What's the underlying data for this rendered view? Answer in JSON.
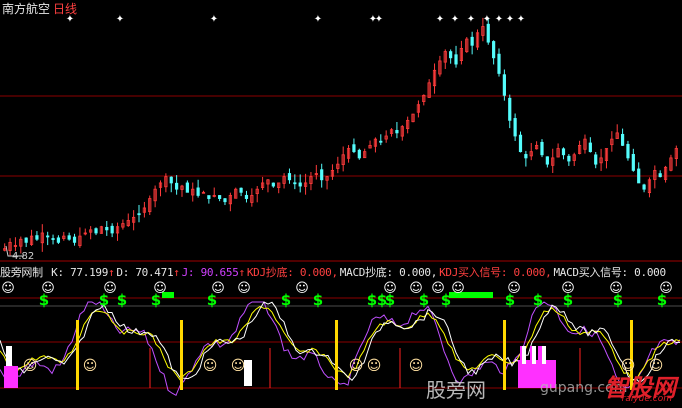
{
  "header": {
    "stock_name": "南方航空",
    "period": "日线"
  },
  "price_label": "4.82",
  "indicator": {
    "name": "股旁网制",
    "items": [
      {
        "text": "K: 77.199",
        "color": "#e6e6e6",
        "arrow": "↑"
      },
      {
        "text": "D: 70.471",
        "color": "#e6e6e6",
        "arrow": "↑"
      },
      {
        "text": "J: 90.655",
        "color": "#d040ff",
        "arrow": "↑"
      },
      {
        "text": "KDJ抄底: 0.000,",
        "color": "#ff4040"
      },
      {
        "text": "MACD抄底: 0.000,",
        "color": "#e6e6e6"
      },
      {
        "text": "KDJ买入信号: 0.000,",
        "color": "#ff4040"
      },
      {
        "text": "MACD买入信号: 0.000",
        "color": "#e6e6e6"
      }
    ]
  },
  "colors": {
    "up": "#ff3b3b",
    "down": "#54fcfc",
    "grid": "#8b0000",
    "k_line": "#ffffff",
    "d_line": "#ffff00",
    "j_line": "#c050ff",
    "signal_green": "#00ff00",
    "smile": "#ffffff"
  },
  "watermark": {
    "text": "股旁网",
    "url": "gupang.com",
    "brand": "智股网",
    "brand_url": "raiyue.com"
  },
  "chart_data": {
    "type": "candlestick",
    "close": [
      4.9,
      5.1,
      5.0,
      5.2,
      5.1,
      5.3,
      5.2,
      5.4,
      5.3,
      5.2,
      5.1,
      5.3,
      5.2,
      5.1,
      5.3,
      5.4,
      5.5,
      5.4,
      5.6,
      5.5,
      5.4,
      5.6,
      5.7,
      5.8,
      5.9,
      6.0,
      6.2,
      6.5,
      6.8,
      7.0,
      7.2,
      7.0,
      6.8,
      6.9,
      6.7,
      6.8,
      6.6,
      6.7,
      6.5,
      6.6,
      6.5,
      6.4,
      6.6,
      6.8,
      6.7,
      6.5,
      6.6,
      6.8,
      7.0,
      7.1,
      6.9,
      7.0,
      7.2,
      7.1,
      7.0,
      6.9,
      7.0,
      7.2,
      7.3,
      7.1,
      7.2,
      7.4,
      7.6,
      7.9,
      8.1,
      8.0,
      7.8,
      8.0,
      8.2,
      8.4,
      8.3,
      8.5,
      8.7,
      8.6,
      8.8,
      9.0,
      9.2,
      9.5,
      9.8,
      10.2,
      10.6,
      10.9,
      11.2,
      11.0,
      10.8,
      11.3,
      11.6,
      11.4,
      11.8,
      12.0,
      11.5,
      11.0,
      10.5,
      9.8,
      9.0,
      8.5,
      8.0,
      7.8,
      8.0,
      8.2,
      7.9,
      7.6,
      7.8,
      8.1,
      7.9,
      7.7,
      7.9,
      8.2,
      8.4,
      8.0,
      7.6,
      7.8,
      8.1,
      8.4,
      8.6,
      8.2,
      7.8,
      7.4,
      7.0,
      6.8,
      7.1,
      7.4,
      7.2,
      7.5,
      7.8,
      8.1
    ]
  }
}
